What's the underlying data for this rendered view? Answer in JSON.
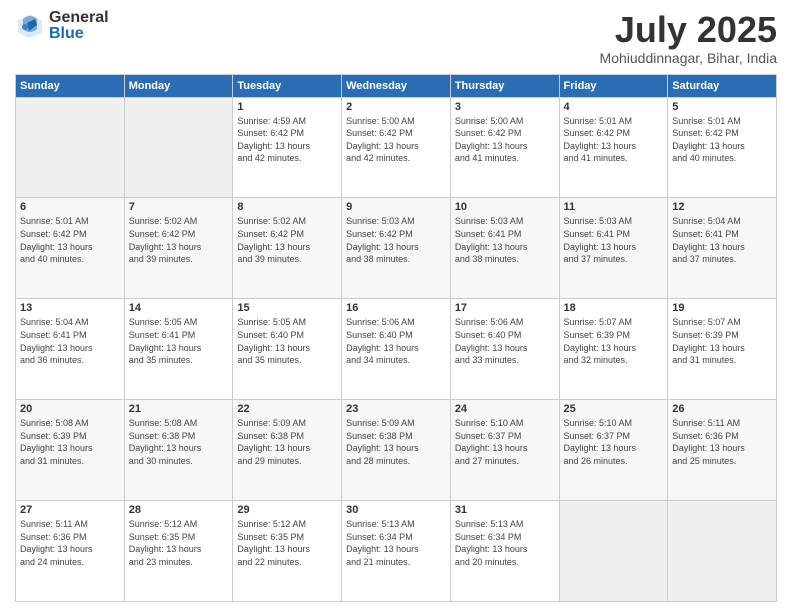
{
  "header": {
    "logo_general": "General",
    "logo_blue": "Blue",
    "month_year": "July 2025",
    "location": "Mohiuddinnagar, Bihar, India"
  },
  "days_of_week": [
    "Sunday",
    "Monday",
    "Tuesday",
    "Wednesday",
    "Thursday",
    "Friday",
    "Saturday"
  ],
  "weeks": [
    [
      {
        "day": "",
        "info": ""
      },
      {
        "day": "",
        "info": ""
      },
      {
        "day": "1",
        "info": "Sunrise: 4:59 AM\nSunset: 6:42 PM\nDaylight: 13 hours\nand 42 minutes."
      },
      {
        "day": "2",
        "info": "Sunrise: 5:00 AM\nSunset: 6:42 PM\nDaylight: 13 hours\nand 42 minutes."
      },
      {
        "day": "3",
        "info": "Sunrise: 5:00 AM\nSunset: 6:42 PM\nDaylight: 13 hours\nand 41 minutes."
      },
      {
        "day": "4",
        "info": "Sunrise: 5:01 AM\nSunset: 6:42 PM\nDaylight: 13 hours\nand 41 minutes."
      },
      {
        "day": "5",
        "info": "Sunrise: 5:01 AM\nSunset: 6:42 PM\nDaylight: 13 hours\nand 40 minutes."
      }
    ],
    [
      {
        "day": "6",
        "info": "Sunrise: 5:01 AM\nSunset: 6:42 PM\nDaylight: 13 hours\nand 40 minutes."
      },
      {
        "day": "7",
        "info": "Sunrise: 5:02 AM\nSunset: 6:42 PM\nDaylight: 13 hours\nand 39 minutes."
      },
      {
        "day": "8",
        "info": "Sunrise: 5:02 AM\nSunset: 6:42 PM\nDaylight: 13 hours\nand 39 minutes."
      },
      {
        "day": "9",
        "info": "Sunrise: 5:03 AM\nSunset: 6:42 PM\nDaylight: 13 hours\nand 38 minutes."
      },
      {
        "day": "10",
        "info": "Sunrise: 5:03 AM\nSunset: 6:41 PM\nDaylight: 13 hours\nand 38 minutes."
      },
      {
        "day": "11",
        "info": "Sunrise: 5:03 AM\nSunset: 6:41 PM\nDaylight: 13 hours\nand 37 minutes."
      },
      {
        "day": "12",
        "info": "Sunrise: 5:04 AM\nSunset: 6:41 PM\nDaylight: 13 hours\nand 37 minutes."
      }
    ],
    [
      {
        "day": "13",
        "info": "Sunrise: 5:04 AM\nSunset: 6:41 PM\nDaylight: 13 hours\nand 36 minutes."
      },
      {
        "day": "14",
        "info": "Sunrise: 5:05 AM\nSunset: 6:41 PM\nDaylight: 13 hours\nand 35 minutes."
      },
      {
        "day": "15",
        "info": "Sunrise: 5:05 AM\nSunset: 6:40 PM\nDaylight: 13 hours\nand 35 minutes."
      },
      {
        "day": "16",
        "info": "Sunrise: 5:06 AM\nSunset: 6:40 PM\nDaylight: 13 hours\nand 34 minutes."
      },
      {
        "day": "17",
        "info": "Sunrise: 5:06 AM\nSunset: 6:40 PM\nDaylight: 13 hours\nand 33 minutes."
      },
      {
        "day": "18",
        "info": "Sunrise: 5:07 AM\nSunset: 6:39 PM\nDaylight: 13 hours\nand 32 minutes."
      },
      {
        "day": "19",
        "info": "Sunrise: 5:07 AM\nSunset: 6:39 PM\nDaylight: 13 hours\nand 31 minutes."
      }
    ],
    [
      {
        "day": "20",
        "info": "Sunrise: 5:08 AM\nSunset: 6:39 PM\nDaylight: 13 hours\nand 31 minutes."
      },
      {
        "day": "21",
        "info": "Sunrise: 5:08 AM\nSunset: 6:38 PM\nDaylight: 13 hours\nand 30 minutes."
      },
      {
        "day": "22",
        "info": "Sunrise: 5:09 AM\nSunset: 6:38 PM\nDaylight: 13 hours\nand 29 minutes."
      },
      {
        "day": "23",
        "info": "Sunrise: 5:09 AM\nSunset: 6:38 PM\nDaylight: 13 hours\nand 28 minutes."
      },
      {
        "day": "24",
        "info": "Sunrise: 5:10 AM\nSunset: 6:37 PM\nDaylight: 13 hours\nand 27 minutes."
      },
      {
        "day": "25",
        "info": "Sunrise: 5:10 AM\nSunset: 6:37 PM\nDaylight: 13 hours\nand 26 minutes."
      },
      {
        "day": "26",
        "info": "Sunrise: 5:11 AM\nSunset: 6:36 PM\nDaylight: 13 hours\nand 25 minutes."
      }
    ],
    [
      {
        "day": "27",
        "info": "Sunrise: 5:11 AM\nSunset: 6:36 PM\nDaylight: 13 hours\nand 24 minutes."
      },
      {
        "day": "28",
        "info": "Sunrise: 5:12 AM\nSunset: 6:35 PM\nDaylight: 13 hours\nand 23 minutes."
      },
      {
        "day": "29",
        "info": "Sunrise: 5:12 AM\nSunset: 6:35 PM\nDaylight: 13 hours\nand 22 minutes."
      },
      {
        "day": "30",
        "info": "Sunrise: 5:13 AM\nSunset: 6:34 PM\nDaylight: 13 hours\nand 21 minutes."
      },
      {
        "day": "31",
        "info": "Sunrise: 5:13 AM\nSunset: 6:34 PM\nDaylight: 13 hours\nand 20 minutes."
      },
      {
        "day": "",
        "info": ""
      },
      {
        "day": "",
        "info": ""
      }
    ]
  ]
}
